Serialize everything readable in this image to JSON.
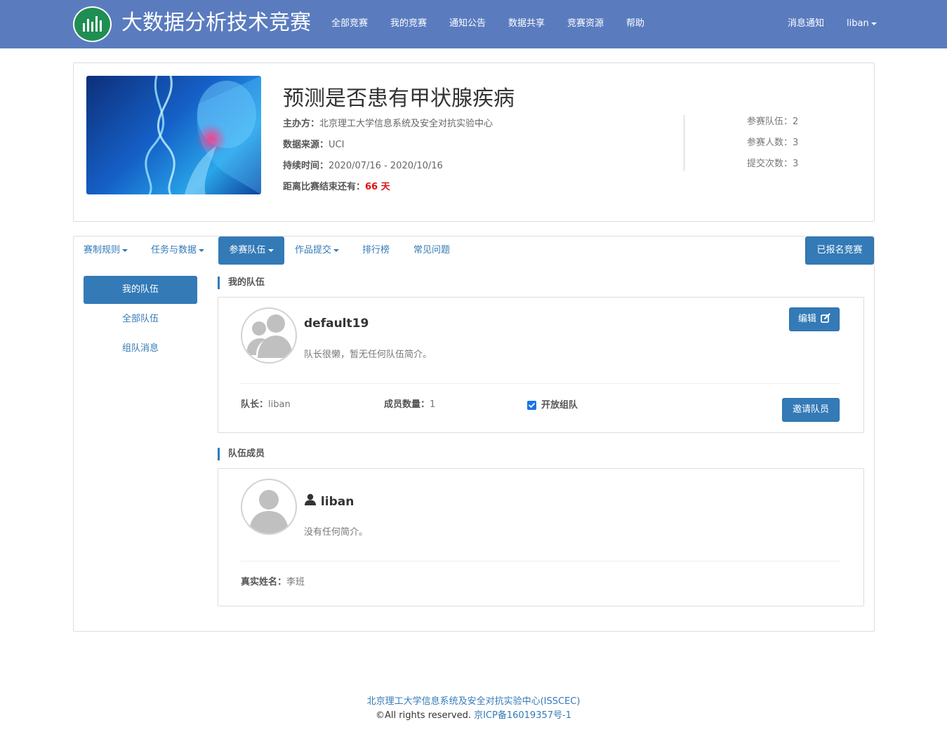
{
  "navbar": {
    "brand": "大数据分析技术竞赛",
    "links": [
      "全部竞赛",
      "我的竞赛",
      "通知公告",
      "数据共享",
      "竞赛资源",
      "帮助"
    ],
    "notifications": "消息通知",
    "user": "liban"
  },
  "competition": {
    "title": "预测是否患有甲状腺疾病",
    "organizer_label": "主办方：",
    "organizer": "北京理工大学信息系统及安全对抗实验中心",
    "source_label": "数据来源：",
    "source": "UCI",
    "duration_label": "持续时间：",
    "duration": "2020/07/16 - 2020/10/16",
    "remaining_label": "距离比赛结束还有：",
    "remaining": "66 天",
    "stats": [
      {
        "label": "参赛队伍：",
        "value": "2"
      },
      {
        "label": "参赛人数：",
        "value": "3"
      },
      {
        "label": "提交次数：",
        "value": "3"
      }
    ]
  },
  "tabs": {
    "rules": "赛制规则",
    "tasks": "任务与数据",
    "teams": "参赛队伍",
    "submit": "作品提交",
    "leaderboard": "排行榜",
    "faq": "常见问题",
    "registered": "已报名竞赛"
  },
  "sidebar": {
    "my_team": "我的队伍",
    "all_teams": "全部队伍",
    "messages": "组队消息"
  },
  "my_team": {
    "heading": "我的队伍",
    "name": "default19",
    "description": "队长很懒，暂无任何队伍简介。",
    "edit_label": "编辑",
    "leader_label": "队长：",
    "leader": "liban",
    "members_label": "成员数量：",
    "members": "1",
    "open_label": "开放组队",
    "invite_label": "邀请队员"
  },
  "members": {
    "heading": "队伍成员",
    "name": "liban",
    "description": "没有任何简介。",
    "realname_label": "真实姓名：",
    "realname": "李班"
  },
  "footer": {
    "org": "北京理工大学信息系统及安全对抗实验中心(ISSCEC)",
    "rights": "©All rights reserved.",
    "icp": "京ICP备16019357号-1"
  }
}
